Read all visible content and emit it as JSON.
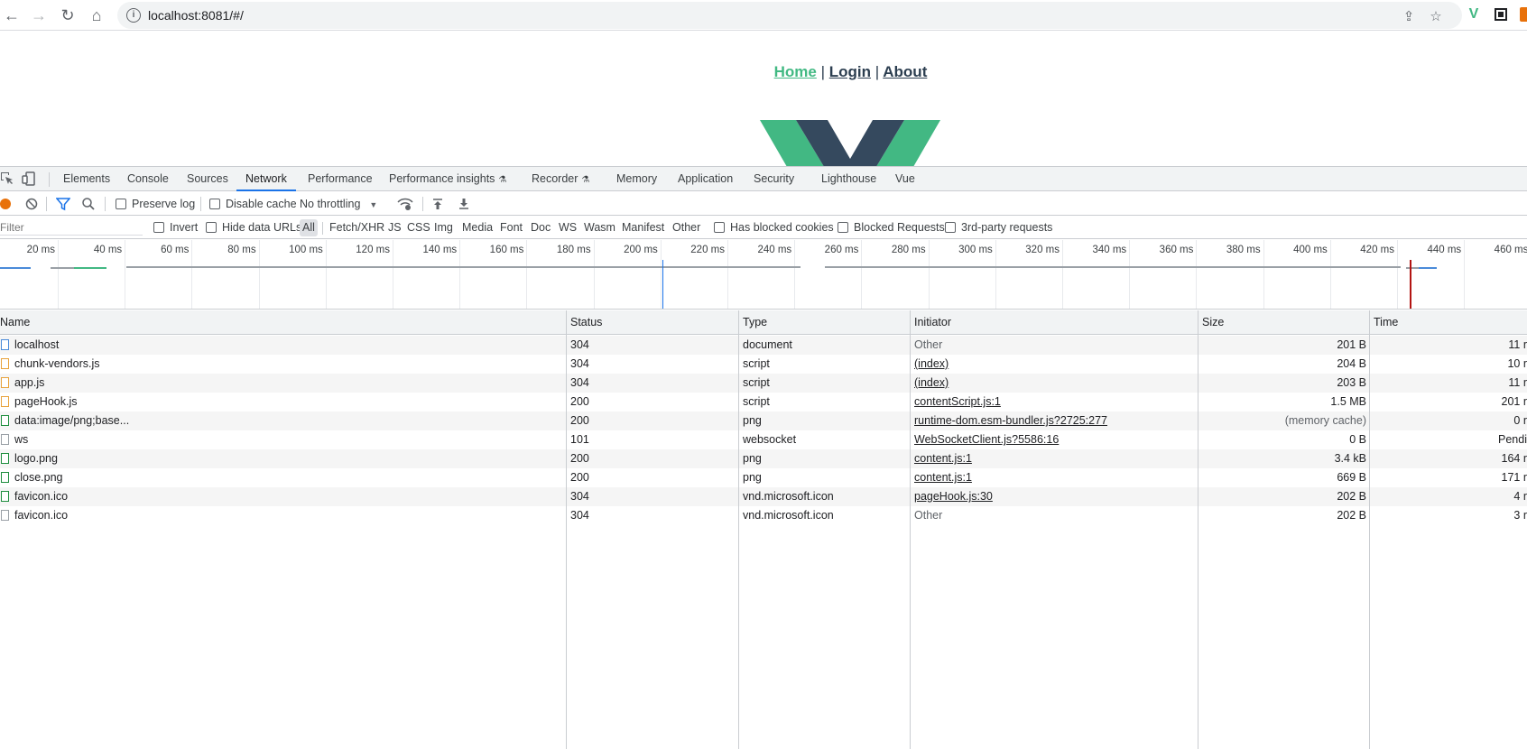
{
  "browser": {
    "url": "localhost:8081/#/",
    "icons": [
      "back-arrow-icon",
      "forward-arrow-icon",
      "reload-icon",
      "home-icon",
      "info-icon",
      "share-icon",
      "bookmark-star-icon",
      "vue-extension-icon",
      "extension-square-icon"
    ]
  },
  "app": {
    "nav": {
      "home": "Home",
      "sep1": "|",
      "login": "Login",
      "sep2": "|",
      "about": "About"
    },
    "logo_colors": {
      "green": "#42b883",
      "dark": "#35495e"
    }
  },
  "devtools": {
    "tabs": [
      "Elements",
      "Console",
      "Sources",
      "Network",
      "Performance",
      "Performance insights",
      "Recorder",
      "Memory",
      "Application",
      "Security",
      "Lighthouse",
      "Vue"
    ],
    "active_tab": "Network",
    "toolbar": {
      "preserve_log": "Preserve log",
      "disable_cache": "Disable cache",
      "throttling": "No throttling"
    },
    "filter": {
      "placeholder": "Filter",
      "invert": "Invert",
      "hide_data_urls": "Hide data URLs",
      "types": [
        "All",
        "Fetch/XHR",
        "JS",
        "CSS",
        "Img",
        "Media",
        "Font",
        "Doc",
        "WS",
        "Wasm",
        "Manifest",
        "Other"
      ],
      "has_blocked_cookies": "Has blocked cookies",
      "blocked_requests": "Blocked Requests",
      "third_party": "3rd-party requests"
    },
    "timeline": {
      "ticks": [
        "20 ms",
        "40 ms",
        "60 ms",
        "80 ms",
        "100 ms",
        "120 ms",
        "140 ms",
        "160 ms",
        "180 ms",
        "200 ms",
        "220 ms",
        "240 ms",
        "260 ms",
        "280 ms",
        "300 ms",
        "320 ms",
        "340 ms",
        "360 ms",
        "380 ms",
        "400 ms",
        "420 ms",
        "440 ms",
        "460 ms"
      ],
      "dom_content_loaded_color": "#1a73e8",
      "load_color": "#b31412"
    },
    "table": {
      "headers": {
        "name": "Name",
        "status": "Status",
        "type": "Type",
        "initiator": "Initiator",
        "size": "Size",
        "time": "Time"
      },
      "rows": [
        {
          "name": "localhost",
          "status": "304",
          "type": "document",
          "initiator": "Other",
          "initiator_link": false,
          "size": "201 B",
          "time": "11 r",
          "icon": "document-icon"
        },
        {
          "name": "chunk-vendors.js",
          "status": "304",
          "type": "script",
          "initiator": "(index)",
          "initiator_link": true,
          "size": "204 B",
          "time": "10 r",
          "icon": "script-icon"
        },
        {
          "name": "app.js",
          "status": "304",
          "type": "script",
          "initiator": "(index)",
          "initiator_link": true,
          "size": "203 B",
          "time": "11 r",
          "icon": "script-icon"
        },
        {
          "name": "pageHook.js",
          "status": "200",
          "type": "script",
          "initiator": "contentScript.js:1",
          "initiator_link": true,
          "size": "1.5 MB",
          "time": "201 r",
          "icon": "script-icon"
        },
        {
          "name": "data:image/png;base...",
          "status": "200",
          "type": "png",
          "initiator": "runtime-dom.esm-bundler.js?2725:277",
          "initiator_link": true,
          "size": "(memory cache)",
          "time": "0 r",
          "icon": "image-icon"
        },
        {
          "name": "ws",
          "status": "101",
          "type": "websocket",
          "initiator": "WebSocketClient.js?5586:16",
          "initiator_link": true,
          "size": "0 B",
          "time": "Pendi",
          "icon": "websocket-icon"
        },
        {
          "name": "logo.png",
          "status": "200",
          "type": "png",
          "initiator": "content.js:1",
          "initiator_link": true,
          "size": "3.4 kB",
          "time": "164 r",
          "icon": "image-icon"
        },
        {
          "name": "close.png",
          "status": "200",
          "type": "png",
          "initiator": "content.js:1",
          "initiator_link": true,
          "size": "669 B",
          "time": "171 r",
          "icon": "image-icon"
        },
        {
          "name": "favicon.ico",
          "status": "304",
          "type": "vnd.microsoft.icon",
          "initiator": "pageHook.js:30",
          "initiator_link": true,
          "size": "202 B",
          "time": "4 r",
          "icon": "image-icon"
        },
        {
          "name": "favicon.ico",
          "status": "304",
          "type": "vnd.microsoft.icon",
          "initiator": "Other",
          "initiator_link": false,
          "size": "202 B",
          "time": "3 r",
          "icon": "generic-file-icon"
        }
      ]
    }
  }
}
